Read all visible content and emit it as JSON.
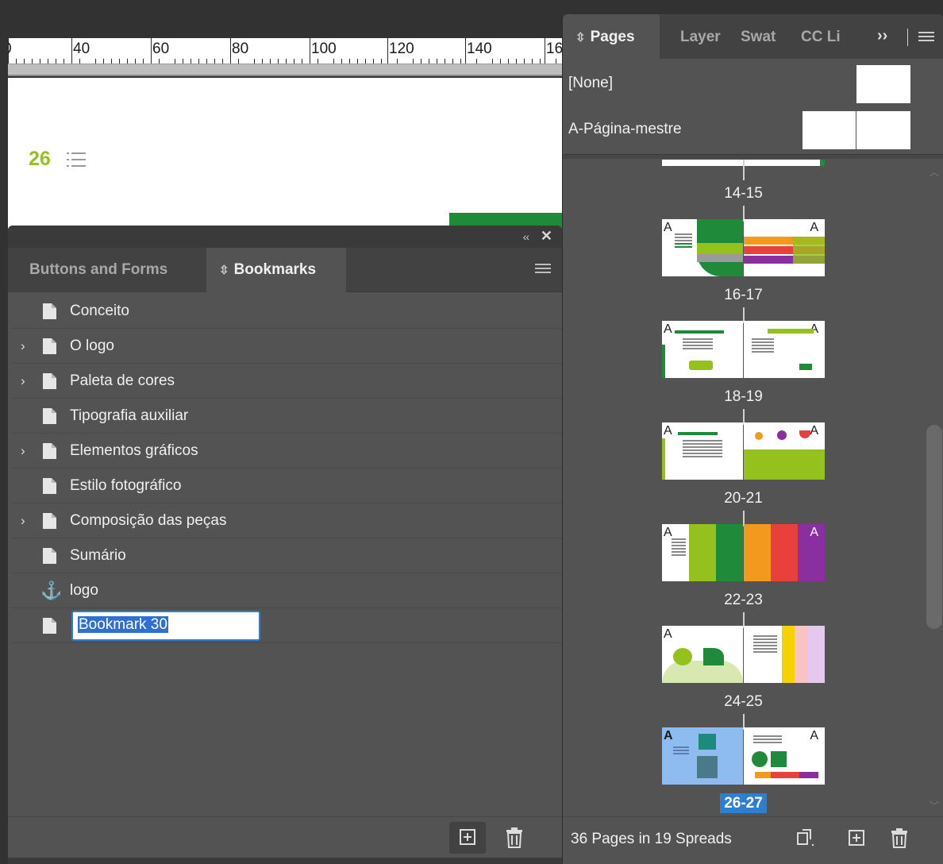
{
  "ruler": {
    "labels": [
      "0",
      "40",
      "60",
      "80",
      "100",
      "120",
      "140",
      "16"
    ]
  },
  "document": {
    "page_number": "26"
  },
  "bookmarks_panel": {
    "tabs": [
      {
        "label": "Buttons and Forms",
        "active": false
      },
      {
        "label": "Bookmarks",
        "active": true
      }
    ],
    "collapse_glyph": "‹‹",
    "close_glyph": "✕",
    "items": [
      {
        "label": "Conceito",
        "expandable": false,
        "icon": "document-icon"
      },
      {
        "label": "O logo",
        "expandable": true,
        "icon": "document-icon"
      },
      {
        "label": "Paleta de cores",
        "expandable": true,
        "icon": "document-icon"
      },
      {
        "label": "Tipografia auxiliar",
        "expandable": false,
        "icon": "document-icon"
      },
      {
        "label": "Elementos gráficos",
        "expandable": true,
        "icon": "document-icon"
      },
      {
        "label": "Estilo fotográfico",
        "expandable": false,
        "icon": "document-icon"
      },
      {
        "label": "Composição das peças",
        "expandable": true,
        "icon": "document-icon"
      },
      {
        "label": "Sumário",
        "expandable": false,
        "icon": "document-icon"
      },
      {
        "label": "logo",
        "expandable": false,
        "icon": "anchor-icon"
      }
    ],
    "editing_item": {
      "value": "Bookmark 30",
      "icon": "document-icon"
    }
  },
  "pages_panel": {
    "tabs": [
      {
        "label": "Pages",
        "active": true
      },
      {
        "label": "Layer",
        "active": false
      },
      {
        "label": "Swat",
        "active": false
      },
      {
        "label": "CC Li",
        "active": false
      }
    ],
    "overflow_glyph": "››",
    "masters": [
      {
        "label": "[None]"
      },
      {
        "label": "A-Página-mestre"
      }
    ],
    "master_prefix": "A",
    "spreads": [
      {
        "label": "14-15",
        "selected": false
      },
      {
        "label": "16-17",
        "selected": false
      },
      {
        "label": "18-19",
        "selected": false
      },
      {
        "label": "20-21",
        "selected": false
      },
      {
        "label": "22-23",
        "selected": false
      },
      {
        "label": "24-25",
        "selected": false
      },
      {
        "label": "26-27",
        "selected": true
      }
    ],
    "footer_status": "36 Pages in 19 Spreads"
  },
  "colors": {
    "accent_green": "#95c11f",
    "dark_green": "#1e8a3a",
    "selection_blue": "#2d7fd3",
    "panel_bg": "#535353"
  }
}
